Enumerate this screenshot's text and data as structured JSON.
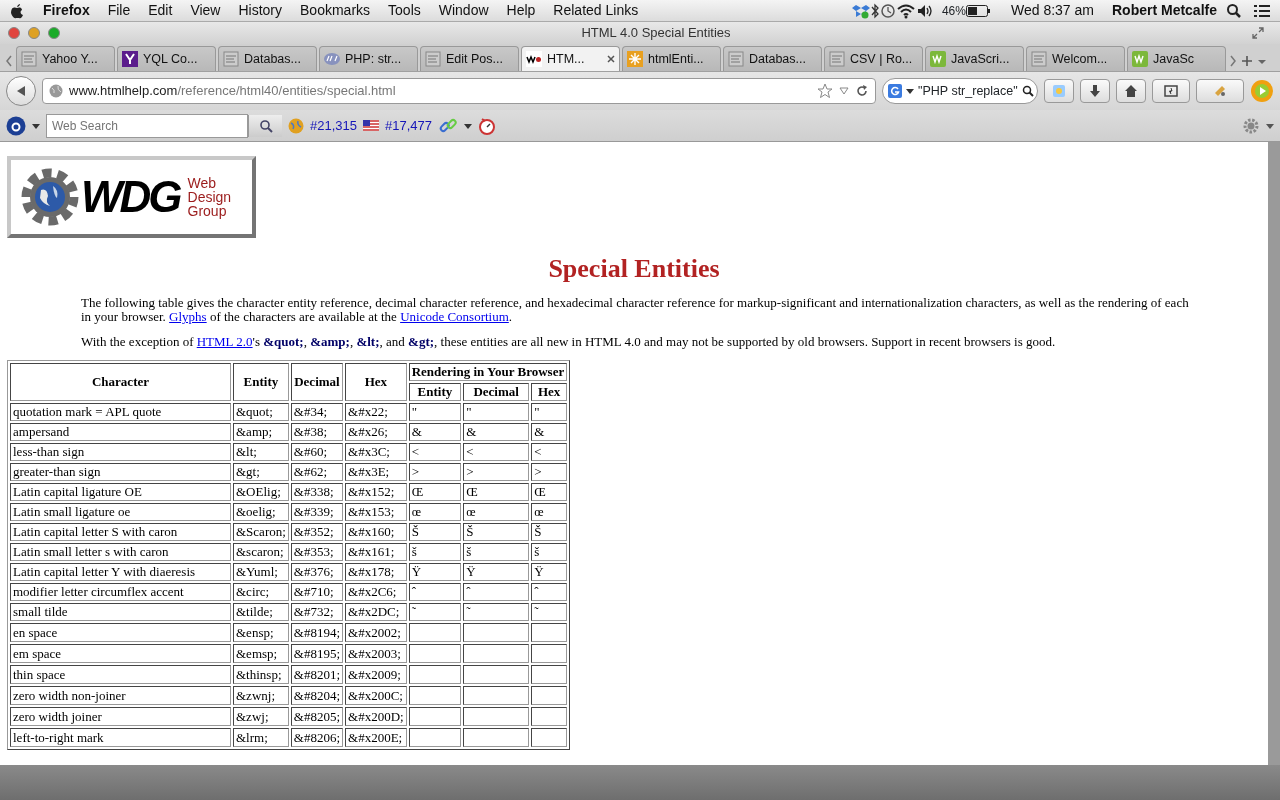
{
  "menu_bar": {
    "app": "Firefox",
    "menus": [
      "File",
      "Edit",
      "View",
      "History",
      "Bookmarks",
      "Tools",
      "Window",
      "Help",
      "Related Links"
    ],
    "battery": "46%",
    "clock": "Wed 8:37 am",
    "user": "Robert Metcalfe"
  },
  "window": {
    "title": "HTML 4.0 Special Entities"
  },
  "tabs": [
    {
      "label": "Yahoo Y...",
      "kind": "page",
      "selected": false
    },
    {
      "label": "YQL Co...",
      "kind": "yahoo",
      "selected": false
    },
    {
      "label": "Databas...",
      "kind": "page",
      "selected": false
    },
    {
      "label": "PHP: str...",
      "kind": "php",
      "selected": false
    },
    {
      "label": "Edit Pos...",
      "kind": "page",
      "selected": false
    },
    {
      "label": "HTM...",
      "kind": "wdg",
      "selected": true
    },
    {
      "label": "htmlEnti...",
      "kind": "star",
      "selected": false
    },
    {
      "label": "Databas...",
      "kind": "page",
      "selected": false
    },
    {
      "label": "CSV | Ro...",
      "kind": "page",
      "selected": false
    },
    {
      "label": "JavaScri...",
      "kind": "w3",
      "selected": false
    },
    {
      "label": "Welcom...",
      "kind": "page",
      "selected": false
    },
    {
      "label": "JavaSc",
      "kind": "w3",
      "selected": false
    }
  ],
  "address_bar": {
    "host": "www.htmlhelp.com",
    "path": "/reference/html40/entities/special.html"
  },
  "search_box": {
    "value": "\"PHP str_replace\""
  },
  "toolbar": {
    "search_placeholder": "Web Search",
    "rank_1": "#21,315",
    "rank_2": "#17,477"
  },
  "logo": {
    "letters": "WDG",
    "tagline": [
      "Web",
      "Design",
      "Group"
    ]
  },
  "heading": "Special Entities",
  "paragraphs": [
    [
      {
        "kind": "text",
        "text": "The following table gives the character entity reference, decimal character reference, and hexadecimal character reference for markup-significant and internationalization characters, as well as the rendering of each in your browser. "
      },
      {
        "kind": "link",
        "text": "Glyphs"
      },
      {
        "kind": "text",
        "text": " of the characters are available at the "
      },
      {
        "kind": "link",
        "text": "Unicode Consortium"
      },
      {
        "kind": "text",
        "text": "."
      }
    ],
    [
      {
        "kind": "text",
        "text": "With the exception of "
      },
      {
        "kind": "link",
        "text": "HTML 2.0"
      },
      {
        "kind": "text",
        "text": "'s "
      },
      {
        "kind": "bold",
        "text": "&quot;"
      },
      {
        "kind": "text",
        "text": ", "
      },
      {
        "kind": "bold",
        "text": "&amp;"
      },
      {
        "kind": "text",
        "text": ", "
      },
      {
        "kind": "bold",
        "text": "&lt;"
      },
      {
        "kind": "text",
        "text": ", and "
      },
      {
        "kind": "bold",
        "text": "&gt;"
      },
      {
        "kind": "text",
        "text": ", these entities are all new in HTML 4.0 and may not be supported by old browsers. Support in recent browsers is good."
      }
    ]
  ],
  "table": {
    "columns": [
      "Character",
      "Entity",
      "Decimal",
      "Hex"
    ],
    "group_header": "Rendering in Your Browser",
    "sub_columns": [
      "Entity",
      "Decimal",
      "Hex"
    ],
    "rows": [
      {
        "character": "quotation mark = APL quote",
        "entity": "&quot;",
        "decimal": "&#34;",
        "hex": "&#x22;",
        "rendering": [
          "\"",
          "\"",
          "\""
        ]
      },
      {
        "character": "ampersand",
        "entity": "&amp;",
        "decimal": "&#38;",
        "hex": "&#x26;",
        "rendering": [
          "&",
          "&",
          "&"
        ]
      },
      {
        "character": "less-than sign",
        "entity": "&lt;",
        "decimal": "&#60;",
        "hex": "&#x3C;",
        "rendering": [
          "<",
          "<",
          "<"
        ]
      },
      {
        "character": "greater-than sign",
        "entity": "&gt;",
        "decimal": "&#62;",
        "hex": "&#x3E;",
        "rendering": [
          ">",
          ">",
          ">"
        ]
      },
      {
        "character": "Latin capital ligature OE",
        "entity": "&OElig;",
        "decimal": "&#338;",
        "hex": "&#x152;",
        "rendering": [
          "Œ",
          "Œ",
          "Œ"
        ]
      },
      {
        "character": "Latin small ligature oe",
        "entity": "&oelig;",
        "decimal": "&#339;",
        "hex": "&#x153;",
        "rendering": [
          "œ",
          "œ",
          "œ"
        ]
      },
      {
        "character": "Latin capital letter S with caron",
        "entity": "&Scaron;",
        "decimal": "&#352;",
        "hex": "&#x160;",
        "rendering": [
          "Š",
          "Š",
          "Š"
        ]
      },
      {
        "character": "Latin small letter s with caron",
        "entity": "&scaron;",
        "decimal": "&#353;",
        "hex": "&#x161;",
        "rendering": [
          "š",
          "š",
          "š"
        ]
      },
      {
        "character": "Latin capital letter Y with diaeresis",
        "entity": "&Yuml;",
        "decimal": "&#376;",
        "hex": "&#x178;",
        "rendering": [
          "Ÿ",
          "Ÿ",
          "Ÿ"
        ]
      },
      {
        "character": "modifier letter circumflex accent",
        "entity": "&circ;",
        "decimal": "&#710;",
        "hex": "&#x2C6;",
        "rendering": [
          "ˆ",
          "ˆ",
          "ˆ"
        ]
      },
      {
        "character": "small tilde",
        "entity": "&tilde;",
        "decimal": "&#732;",
        "hex": "&#x2DC;",
        "rendering": [
          "˜",
          "˜",
          "˜"
        ]
      },
      {
        "character": "en space",
        "entity": "&ensp;",
        "decimal": "&#8194;",
        "hex": "&#x2002;"
      },
      {
        "character": "em space",
        "entity": "&emsp;",
        "decimal": "&#8195;",
        "hex": "&#x2003;"
      },
      {
        "character": "thin space",
        "entity": "&thinsp;",
        "decimal": "&#8201;",
        "hex": "&#x2009;"
      },
      {
        "character": "zero width non-joiner",
        "entity": "&zwnj;",
        "decimal": "&#8204;",
        "hex": "&#x200C;"
      },
      {
        "character": "zero width joiner",
        "entity": "&zwj;",
        "decimal": "&#8205;",
        "hex": "&#x200D;"
      },
      {
        "character": "left-to-right mark",
        "entity": "&lrm;",
        "decimal": "&#8206;",
        "hex": "&#x200E;"
      }
    ]
  }
}
